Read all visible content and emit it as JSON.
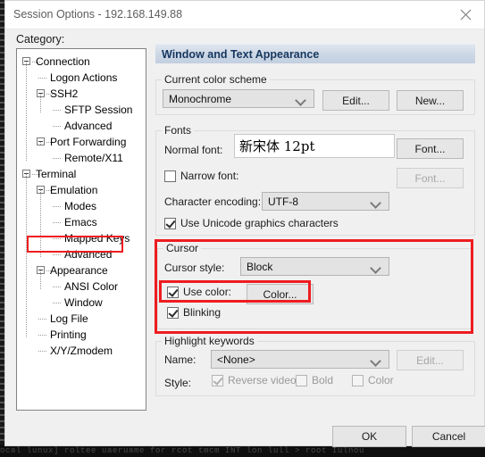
{
  "window": {
    "title": "Session Options - 192.168.149.88",
    "close_icon": "close-icon"
  },
  "category": {
    "label": "Category:",
    "tree": [
      {
        "label": "Connection",
        "depth": 0,
        "expander": "minus"
      },
      {
        "label": "Logon Actions",
        "depth": 1,
        "expander": "none"
      },
      {
        "label": "SSH2",
        "depth": 1,
        "expander": "minus"
      },
      {
        "label": "SFTP Session",
        "depth": 2,
        "expander": "none"
      },
      {
        "label": "Advanced",
        "depth": 2,
        "expander": "none"
      },
      {
        "label": "Port Forwarding",
        "depth": 1,
        "expander": "minus"
      },
      {
        "label": "Remote/X11",
        "depth": 2,
        "expander": "none"
      },
      {
        "label": "Terminal",
        "depth": 0,
        "expander": "minus"
      },
      {
        "label": "Emulation",
        "depth": 1,
        "expander": "minus"
      },
      {
        "label": "Modes",
        "depth": 2,
        "expander": "none"
      },
      {
        "label": "Emacs",
        "depth": 2,
        "expander": "none"
      },
      {
        "label": "Mapped Keys",
        "depth": 2,
        "expander": "none"
      },
      {
        "label": "Advanced",
        "depth": 2,
        "expander": "none"
      },
      {
        "label": "Appearance",
        "depth": 1,
        "expander": "minus",
        "selected": true
      },
      {
        "label": "ANSI Color",
        "depth": 2,
        "expander": "none"
      },
      {
        "label": "Window",
        "depth": 2,
        "expander": "none"
      },
      {
        "label": "Log File",
        "depth": 1,
        "expander": "none"
      },
      {
        "label": "Printing",
        "depth": 1,
        "expander": "none"
      },
      {
        "label": "X/Y/Zmodem",
        "depth": 1,
        "expander": "none"
      }
    ]
  },
  "pane": {
    "header": "Window and Text Appearance",
    "color_scheme": {
      "group_title": "Current color scheme",
      "value": "Monochrome",
      "edit_label": "Edit...",
      "new_label": "New..."
    },
    "fonts": {
      "group_title": "Fonts",
      "normal_font_label": "Normal font:",
      "normal_font_value": "新宋体  12pt",
      "normal_font_button": "Font...",
      "narrow_font_label": "Narrow font:",
      "narrow_font_checked": false,
      "narrow_font_button": "Font...",
      "encoding_label": "Character encoding:",
      "encoding_value": "UTF-8",
      "unicode_graphics_label": "Use Unicode graphics characters",
      "unicode_graphics_checked": true
    },
    "cursor": {
      "group_title": "Cursor",
      "style_label": "Cursor style:",
      "style_value": "Block",
      "use_color_label": "Use color:",
      "use_color_checked": true,
      "color_button": "Color...",
      "blinking_label": "Blinking",
      "blinking_checked": true
    },
    "highlight": {
      "group_title": "Highlight keywords",
      "name_label": "Name:",
      "name_value": "<None>",
      "edit_label": "Edit...",
      "style_label": "Style:",
      "reverse_video_label": "Reverse video",
      "reverse_video_checked": true,
      "bold_label": "Bold",
      "bold_checked": false,
      "color_label": "Color",
      "color_checked": false
    }
  },
  "footer": {
    "ok_label": "OK",
    "cancel_label": "Cancel"
  },
  "annotation": {
    "accent_color": "#ee1c20"
  },
  "background_terminal": {
    "bottom_line": "ocal lunux]  roltee uaeruame for  rcot  tmcm  INT  lon  lull  >  root  Iulnou"
  }
}
